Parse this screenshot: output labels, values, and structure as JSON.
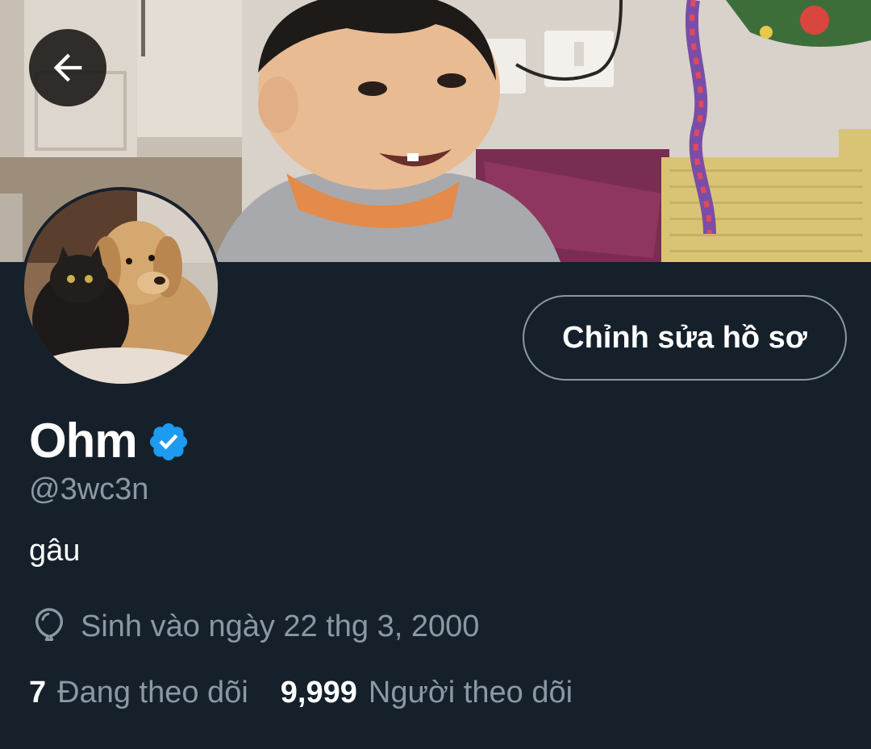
{
  "header": {
    "back_icon": "arrow-left-icon",
    "banner_image": "banner-photo-smiling-toddler",
    "avatar_image": "avatar-photo-dog-and-cat"
  },
  "profile": {
    "edit_button_label": "Chỉnh sửa hồ sơ",
    "display_name": "Ohm",
    "verified_icon": "verified-badge-icon",
    "handle": "@3wc3n",
    "bio": "gâu",
    "birthday_icon": "balloon-icon",
    "birthday": "Sinh vào ngày 22 thg 3, 2000",
    "following_count": "7",
    "following_label": "Đang theo dõi",
    "followers_count": "9,999",
    "followers_label": "Người theo dõi"
  },
  "colors": {
    "background": "#15202b",
    "text_primary": "#ffffff",
    "text_secondary": "#8b98a5",
    "accent": "#1d9bf0",
    "button_border": "#8b98a5"
  }
}
